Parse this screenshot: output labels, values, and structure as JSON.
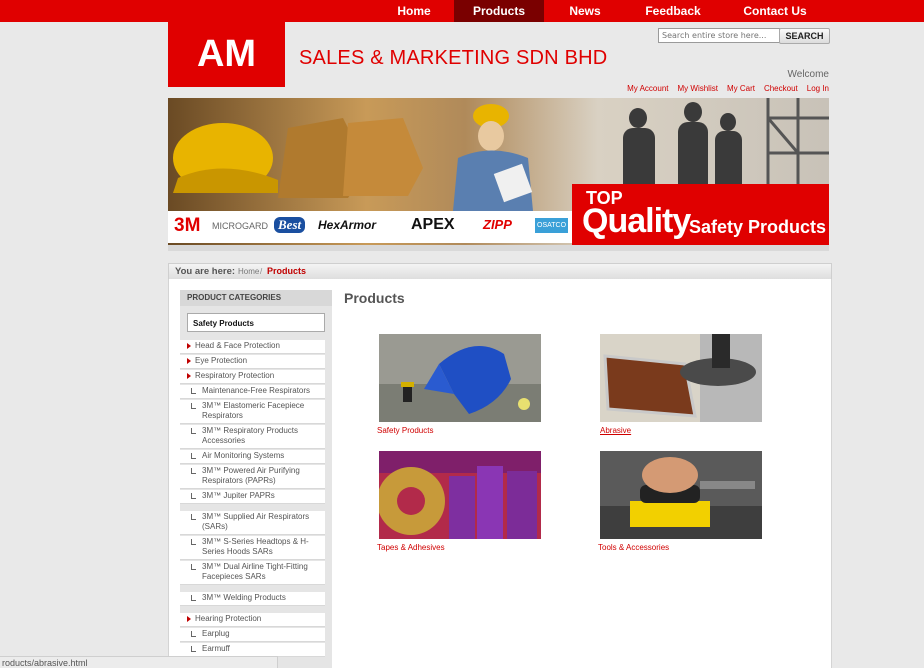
{
  "topnav": {
    "items": [
      {
        "label": "Home",
        "active": false
      },
      {
        "label": "Products",
        "active": true
      },
      {
        "label": "News",
        "active": false
      },
      {
        "label": "Feedback",
        "active": false
      },
      {
        "label": "Contact Us",
        "active": false
      }
    ]
  },
  "header": {
    "logo_text": "AM",
    "company": "SALES & MARKETING SDN BHD",
    "search_placeholder": "Search entire store here...",
    "search_button": "SEARCH",
    "welcome": "Welcome",
    "account_links": [
      "My Account",
      "My Wishlist",
      "My Cart",
      "Checkout",
      "Log In"
    ]
  },
  "banner": {
    "tag_top": "TOP",
    "tag_quality": "Quality",
    "tag_rest": "Safety Products",
    "brand_logos": [
      "3M",
      "MICROGARD",
      "Best",
      "HexArmor",
      "APEX",
      "ZIPP",
      "OSATCO"
    ]
  },
  "breadcrumb": {
    "label": "You are here:",
    "home": "Home",
    "sep": "/",
    "current": "Products"
  },
  "sidebar": {
    "title": "PRODUCT CATEGORIES",
    "selected": "Safety Products",
    "items": [
      {
        "label": "Head & Face Protection",
        "level": 1
      },
      {
        "label": "Eye Protection",
        "level": 1
      },
      {
        "label": "Respiratory Protection",
        "level": 1
      },
      {
        "label": "Maintenance-Free Respirators",
        "level": 2
      },
      {
        "label": "3M™ Elastomeric Facepiece Respirators",
        "level": 2
      },
      {
        "label": "3M™ Respiratory Products Accessories",
        "level": 2
      },
      {
        "label": "Air Monitoring Systems",
        "level": 2
      },
      {
        "label": "3M™ Powered Air Purifying Respirators (PAPRs)",
        "level": 2
      },
      {
        "label": "3M™ Jupiter PAPRs",
        "level": 2
      },
      {
        "label": "3M™ Supplied Air Respirators (SARs)",
        "level": 2
      },
      {
        "label": "3M™ S-Series Headtops & H-Series Hoods SARs",
        "level": 2
      },
      {
        "label": "3M™ Dual Airline Tight-Fitting Facepieces SARs",
        "level": 2
      },
      {
        "label": "3M™ Welding Products",
        "level": 2
      },
      {
        "label": "Hearing Protection",
        "level": 1
      },
      {
        "label": "Earplug",
        "level": 2
      },
      {
        "label": "Earmuff",
        "level": 2
      }
    ]
  },
  "main": {
    "title": "Products",
    "products": [
      {
        "label": "Safety Products",
        "underlined": false
      },
      {
        "label": "Abrasive",
        "underlined": true
      },
      {
        "label": "Tapes & Adhesives",
        "underlined": false
      },
      {
        "label": "Tools & Accessories",
        "underlined": false
      }
    ]
  },
  "status": {
    "url": "roducts/abrasive.html"
  },
  "colors": {
    "brand_red": "#e00000",
    "nav_active": "#7a0000",
    "link_red": "#d00000"
  }
}
